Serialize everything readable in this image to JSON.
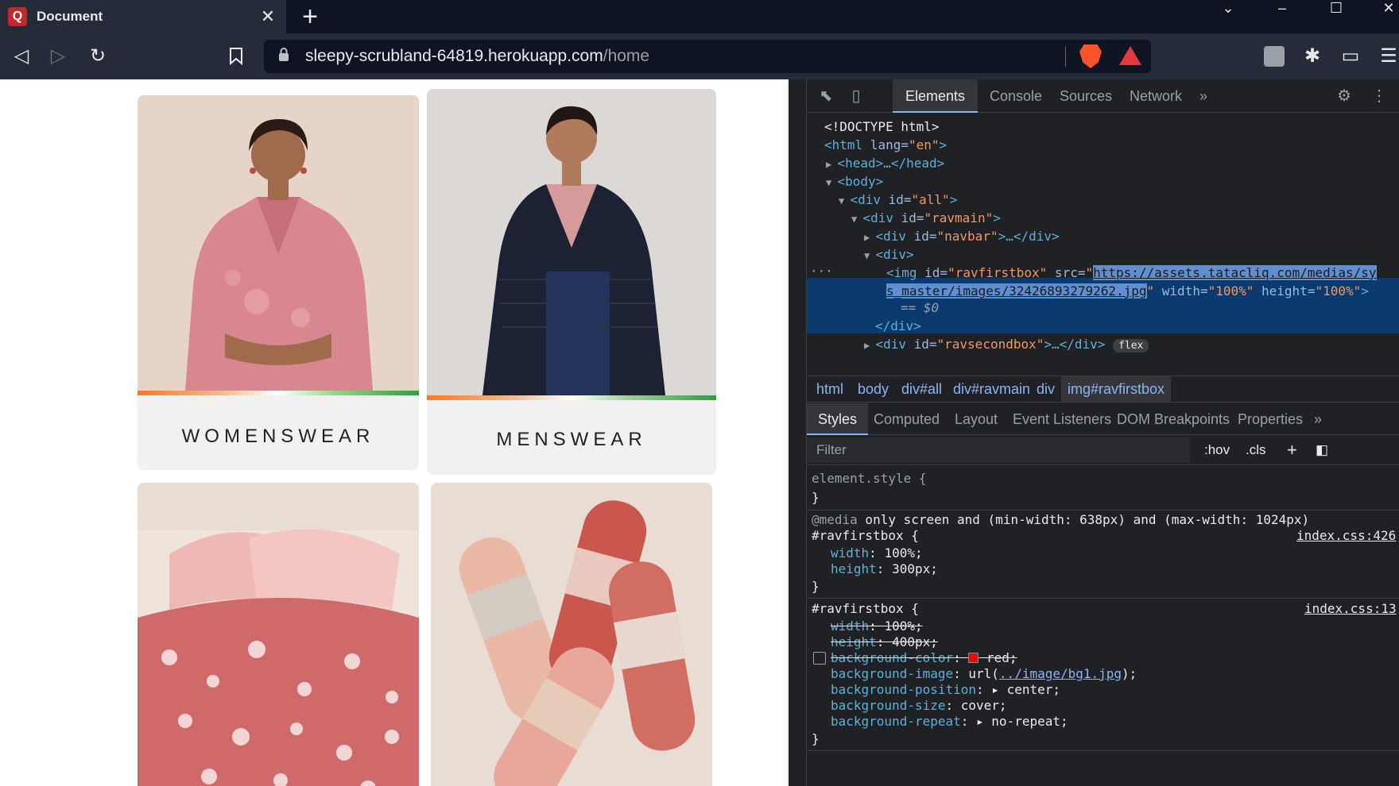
{
  "browser": {
    "tab_title": "Document",
    "tab_favicon": "Q",
    "tab_close": "✕",
    "new_tab": "+",
    "url_host": "sleepy-scrubland-64819.herokuapp.com",
    "url_path": "/home"
  },
  "page": {
    "cards": [
      {
        "label": "WOMENSWEAR",
        "image": "woman-pink-kurta"
      },
      {
        "label": "MENSWEAR",
        "image": "man-black-jacket"
      },
      {
        "label": "",
        "image": "pink-floral-bedding"
      },
      {
        "label": "",
        "image": "embellished-sandals"
      }
    ]
  },
  "devtools": {
    "tabs": [
      "Elements",
      "Console",
      "Sources",
      "Network"
    ],
    "more_tabs": "»",
    "dom_lines": {
      "doctype": "<!DOCTYPE html>",
      "html_open_tag": "<html",
      "html_attr": " lang=",
      "html_val": "\"en\"",
      "html_close": ">",
      "head": "<head>…</head>",
      "body": "<body>",
      "div_all_a": "<div",
      "div_all_b": " id=",
      "div_all_c": "\"all\"",
      "div_all_d": ">",
      "ravmain_a": "<div",
      "ravmain_b": " id=",
      "ravmain_c": "\"ravmain\"",
      "ravmain_d": ">",
      "navbar_a": "<div",
      "navbar_b": " id=",
      "navbar_c": "\"navbar\"",
      "navbar_d": ">…</div>",
      "div_plain": "<div>",
      "img_a": "<img",
      "img_b": " id=",
      "img_c": "\"ravfirstbox\"",
      "img_d": " src=",
      "img_q": "\"",
      "img_url1": "https://assets.tatacliq.com/medias/sy",
      "img_url2": "s_master/images/32426893279262.jpg",
      "img_q2": "\"",
      "img_e": " width=",
      "img_f": "\"100%\"",
      "img_g": " height=",
      "img_h": "\"100%\"",
      "img_i": ">",
      "eq0": "== $0",
      "div_close": "</div>",
      "second_a": "<div",
      "second_b": " id=",
      "second_c": "\"ravsecondbox\"",
      "second_d": ">…</div>",
      "flex": "flex",
      "ellipsis": "···"
    },
    "breadcrumbs": [
      "html",
      "body",
      "div#all",
      "div#ravmain",
      "div",
      "img#ravfirstbox"
    ],
    "subtabs": [
      "Styles",
      "Computed",
      "Layout",
      "Event Listeners",
      "DOM Breakpoints",
      "Properties"
    ],
    "subtabs_more": "»",
    "filter_placeholder": "Filter",
    "hov": ":hov",
    "cls": ".cls",
    "plus": "+",
    "styles": {
      "element_style": "element.style {",
      "close_brace": "}",
      "media_kw": "@media",
      "media_query": " only screen and (min-width: 638px) and (max-width: 1024px)",
      "selector": "#ravfirstbox {",
      "src1": "index.css:426",
      "src2": "index.css:13",
      "r1_width_p": "width",
      "r1_width_v": ": 100%;",
      "r1_height_p": "height",
      "r1_height_v": ": 300px;",
      "r2_width_p": "width",
      "r2_width_v": ": 100%;",
      "r2_height_p": "height",
      "r2_height_v": ": 400px;",
      "bgc_p": "background-color",
      "bgc_sep": ": ",
      "bgc_v": "red;",
      "bgi_p": "background-image",
      "bgi_a": ": url(",
      "bgi_url": "../image/bg1.jpg",
      "bgi_b": ");",
      "bgp_p": "background-position",
      "bgp_v": ": ▸ center;",
      "bgs_p": "background-size",
      "bgs_v": ": cover;",
      "bgr_p": "background-repeat",
      "bgr_v": ": ▸ no-repeat;"
    }
  },
  "colors": {
    "accent": "#8ab4f8",
    "selected_row": "#0a3a6e",
    "tag": "#5db0d7",
    "attr_value": "#f29766"
  }
}
